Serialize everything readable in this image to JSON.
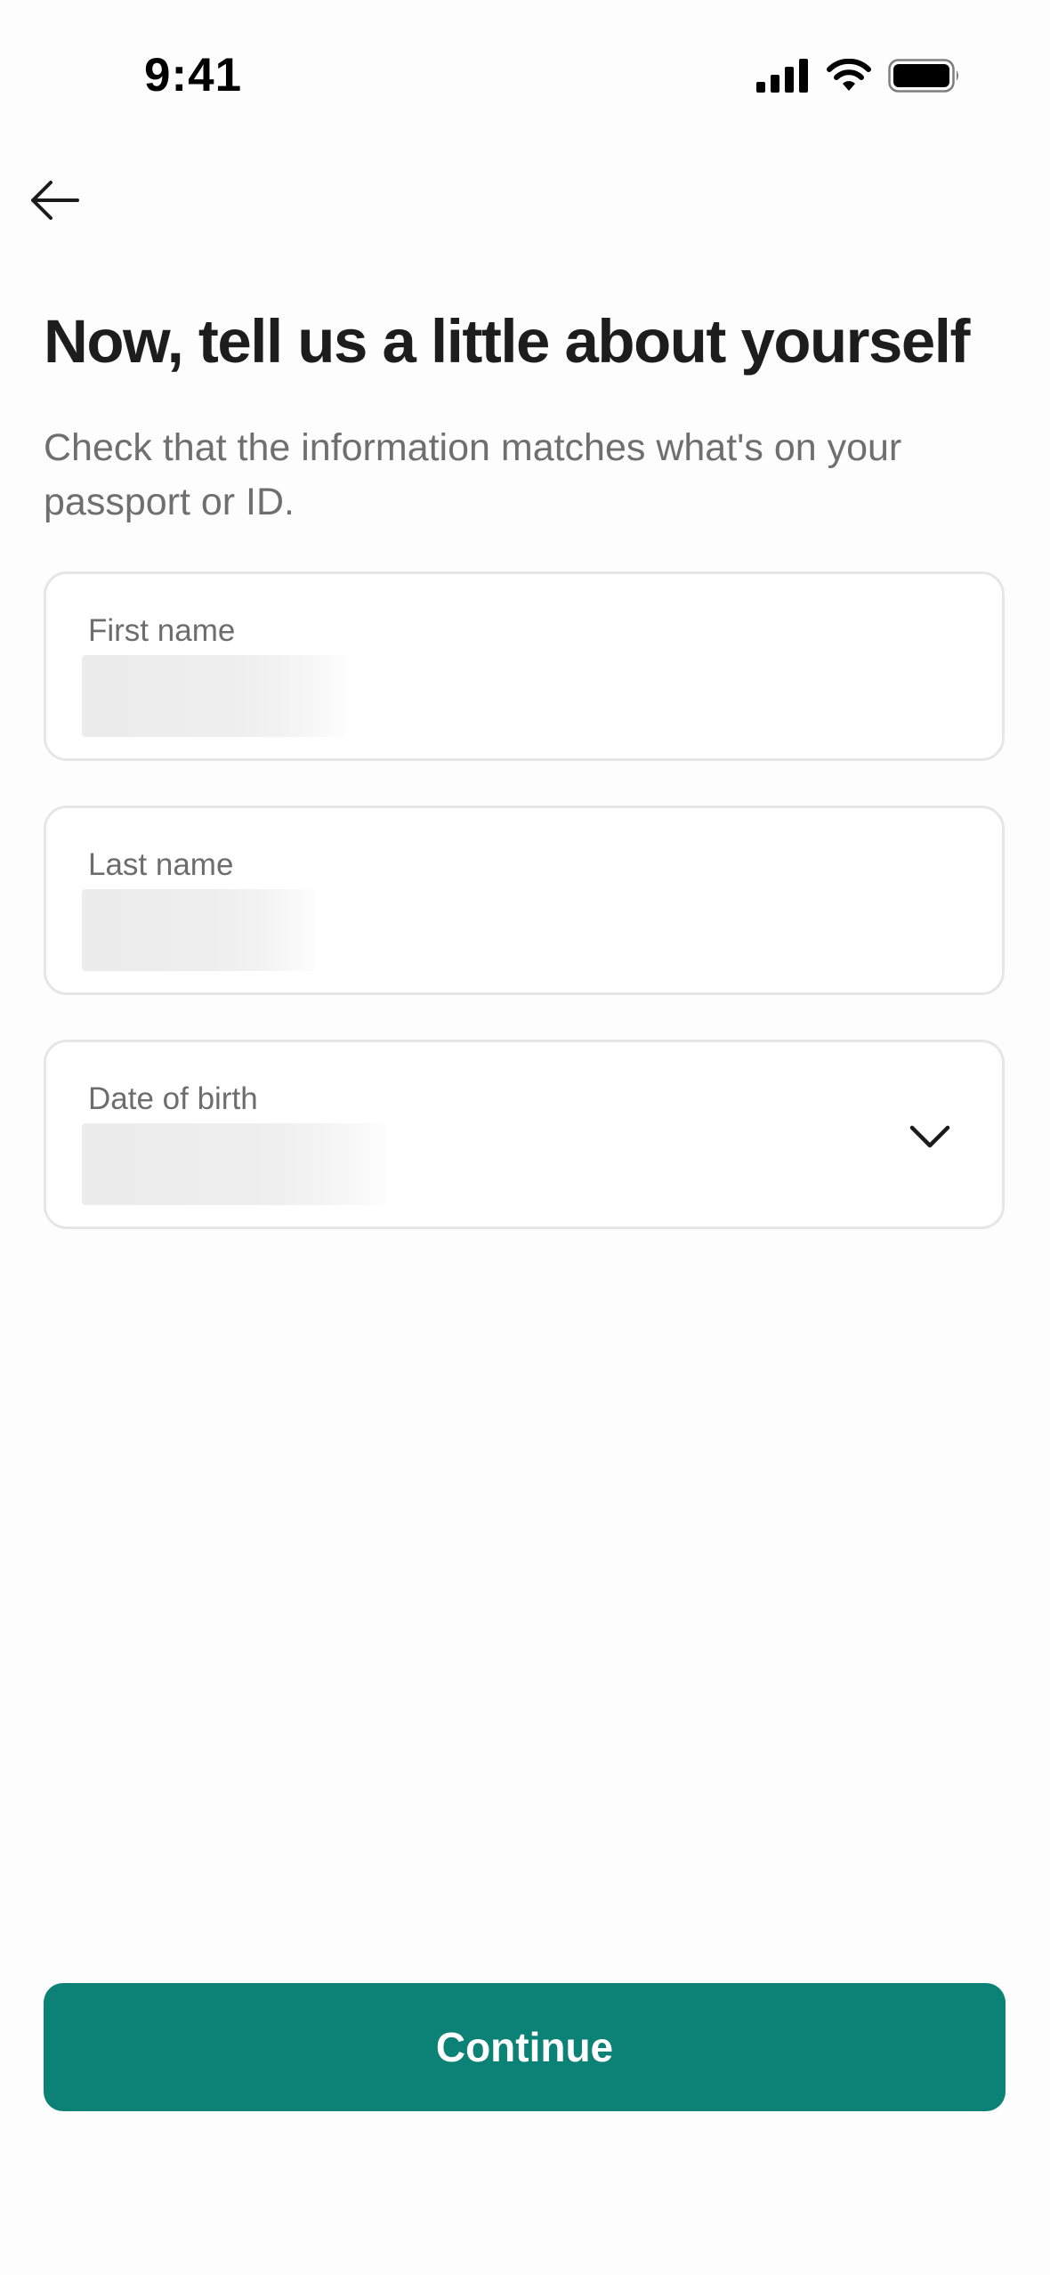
{
  "status_bar": {
    "time": "9:41",
    "icons": [
      "cellular-signal-icon",
      "wifi-icon",
      "battery-icon"
    ]
  },
  "nav": {
    "back_icon": "arrow-left-icon"
  },
  "header": {
    "title": "Now, tell us a little about yourself",
    "subtitle": "Check that the information matches what's on your passport or ID."
  },
  "form": {
    "first_name": {
      "label": "First name",
      "value": ""
    },
    "last_name": {
      "label": "Last name",
      "value": ""
    },
    "date_of_birth": {
      "label": "Date of birth",
      "value": "",
      "icon": "chevron-down-icon"
    }
  },
  "footer": {
    "continue_label": "Continue"
  },
  "colors": {
    "accent": "#0b8275",
    "field_border": "#e6e6e6",
    "muted_text": "#6f6f6f",
    "background": "#fdfdfd"
  }
}
